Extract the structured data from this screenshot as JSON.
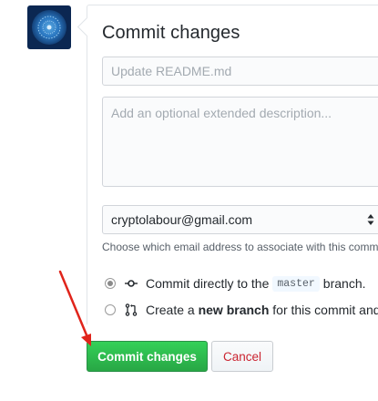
{
  "form": {
    "title": "Commit changes",
    "summary_placeholder": "Update README.md",
    "description_placeholder": "Add an optional extended description...",
    "email_selected": "cryptolabour@gmail.com",
    "email_note": "Choose which email address to associate with this commit"
  },
  "options": {
    "direct": {
      "prefix": "Commit directly to the",
      "branch": "master",
      "suffix": "branch.",
      "checked": true
    },
    "new_branch": {
      "prefix": "Create a",
      "bold": "new branch",
      "suffix": "for this commit and start a pull request.",
      "checked": false
    }
  },
  "buttons": {
    "commit": "Commit changes",
    "cancel": "Cancel"
  },
  "colors": {
    "primary": "#28a745",
    "danger": "#cb2431",
    "annotation_arrow": "#e0241b"
  }
}
